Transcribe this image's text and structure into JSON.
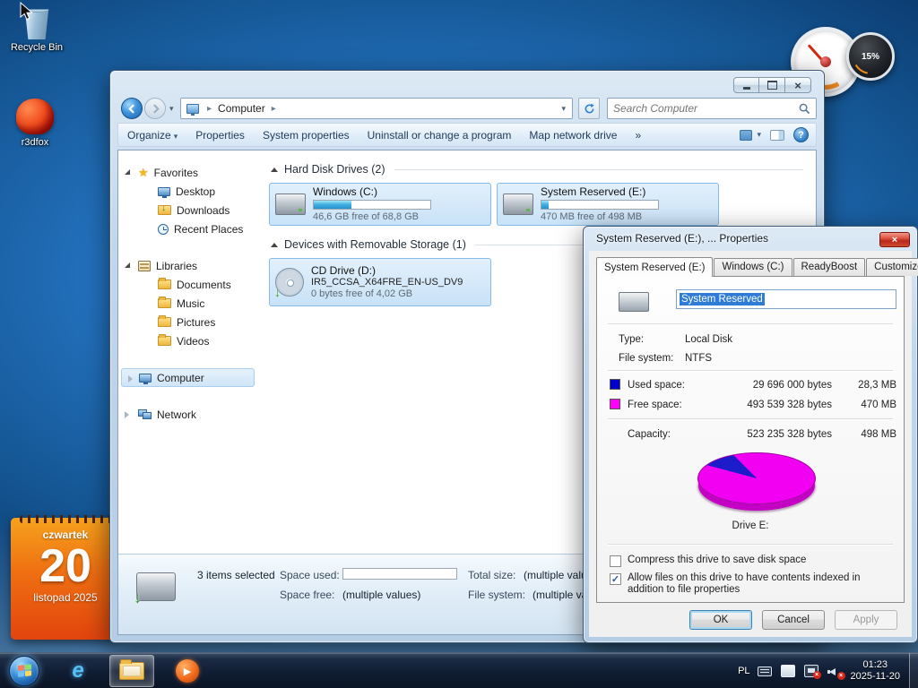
{
  "desktop": {
    "icons": {
      "recycle_bin": "Recycle Bin",
      "r3dfox": "r3dfox"
    },
    "calendar": {
      "weekday": "czwartek",
      "day": "20",
      "month_year": "listopad 2025"
    },
    "cpu_gadget": {
      "value": "15%"
    }
  },
  "explorer": {
    "nav": {
      "breadcrumb_root": "Computer",
      "search_placeholder": "Search Computer"
    },
    "toolbar": {
      "organize": "Organize",
      "properties": "Properties",
      "system_properties": "System properties",
      "uninstall": "Uninstall or change a program",
      "map_drive": "Map network drive",
      "overflow": "»"
    },
    "sidebar": {
      "favorites": "Favorites",
      "desktop": "Desktop",
      "downloads": "Downloads",
      "recent": "Recent Places",
      "libraries": "Libraries",
      "documents": "Documents",
      "music": "Music",
      "pictures": "Pictures",
      "videos": "Videos",
      "computer": "Computer",
      "network": "Network"
    },
    "groups": {
      "hdd_title": "Hard Disk Drives (2)",
      "removable_title": "Devices with Removable Storage (1)"
    },
    "drives": {
      "c": {
        "name": "Windows (C:)",
        "detail": "46,6 GB free of 68,8 GB",
        "used_pct": 32
      },
      "e": {
        "name": "System Reserved (E:)",
        "detail": "470 MB free of 498 MB",
        "used_pct": 6
      },
      "d": {
        "name": "CD Drive (D:)",
        "label": "IR5_CCSA_X64FRE_EN-US_DV9",
        "detail": "0 bytes free of 4,02 GB"
      }
    },
    "details_pane": {
      "selection": "3 items selected",
      "space_used_label": "Space used:",
      "space_free_label": "Space free:",
      "space_free_value": "(multiple values)",
      "total_size_label": "Total size:",
      "total_size_value": "(multiple values)",
      "file_system_label": "File system:",
      "file_system_value": "(multiple values)"
    }
  },
  "dialog": {
    "title": "System Reserved (E:), ... Properties",
    "tabs": [
      "System Reserved (E:)",
      "Windows (C:)",
      "ReadyBoost",
      "Customize"
    ],
    "name_value": "System Reserved",
    "type_label": "Type:",
    "type_value": "Local Disk",
    "fs_label": "File system:",
    "fs_value": "NTFS",
    "used_label": "Used space:",
    "used_bytes": "29 696 000 bytes",
    "used_size": "28,3 MB",
    "free_label": "Free space:",
    "free_bytes": "493 539 328 bytes",
    "free_size": "470 MB",
    "capacity_label": "Capacity:",
    "capacity_bytes": "523 235 328 bytes",
    "capacity_size": "498 MB",
    "drive_caption": "Drive E:",
    "compress_label": "Compress this drive to save disk space",
    "compress_checked": false,
    "index_label": "Allow files on this drive to have contents indexed in addition to file properties",
    "index_checked": true,
    "ok": "OK",
    "cancel": "Cancel",
    "apply": "Apply",
    "colors": {
      "used": "#0000cc",
      "free": "#ff00ff"
    },
    "pie": {
      "used_pct": 5.7,
      "free_pct": 94.3
    }
  },
  "taskbar": {
    "lang": "PL",
    "time": "01:23",
    "date": "2025-11-20"
  }
}
